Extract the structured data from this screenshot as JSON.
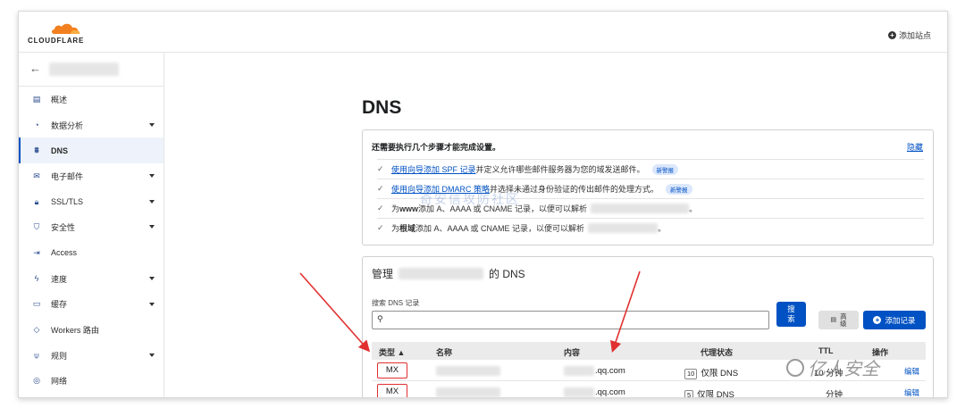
{
  "header": {
    "logo_text": "CLOUDFLARE",
    "add_site_label": "添加站点"
  },
  "sidebar": {
    "items": [
      {
        "label": "概述",
        "icon": "document-icon",
        "has_caret": false,
        "active": false
      },
      {
        "label": "数据分析",
        "icon": "clock-chart-icon",
        "has_caret": true,
        "active": false
      },
      {
        "label": "DNS",
        "icon": "network-icon",
        "has_caret": false,
        "active": true
      },
      {
        "label": "电子邮件",
        "icon": "email-icon",
        "has_caret": true,
        "active": false
      },
      {
        "label": "SSL/TLS",
        "icon": "lock-icon",
        "has_caret": true,
        "active": false
      },
      {
        "label": "安全性",
        "icon": "shield-icon",
        "has_caret": true,
        "active": false
      },
      {
        "label": "Access",
        "icon": "access-icon",
        "has_caret": false,
        "active": false
      },
      {
        "label": "速度",
        "icon": "lightning-icon",
        "has_caret": true,
        "active": false
      },
      {
        "label": "缓存",
        "icon": "storage-icon",
        "has_caret": true,
        "active": false
      },
      {
        "label": "Workers 路由",
        "icon": "workers-icon",
        "has_caret": false,
        "active": false
      },
      {
        "label": "规则",
        "icon": "rules-icon",
        "has_caret": true,
        "active": false
      },
      {
        "label": "网络",
        "icon": "location-icon",
        "has_caret": false,
        "active": false
      }
    ]
  },
  "main": {
    "title": "DNS",
    "setup": {
      "title": "还需要执行几个步骤才能完成设置。",
      "hide_label": "隐藏",
      "steps": [
        {
          "link": "使用向导添加 SPF 记录",
          "text": "并定义允许哪些邮件服务器为您的域发送邮件。",
          "badge": "新警报"
        },
        {
          "link": "使用向导添加 DMARC 策略",
          "text": "并选择未通过身份验证的传出邮件的处理方式。",
          "badge": "新警报"
        },
        {
          "prefix": "为 ",
          "bold": "www",
          "text": " 添加 A、AAAA 或 CNAME 记录，以便可以解析",
          "suffix": "。"
        },
        {
          "prefix": "为 ",
          "bold": "根域",
          "text": "添加 A、AAAA 或 CNAME 记录，以便可以解析",
          "suffix": "。"
        }
      ]
    },
    "dns": {
      "heading_prefix": "管理",
      "heading_suffix": "的 DNS",
      "search_label": "搜索 DNS 记录",
      "search_button": "搜\n索",
      "advanced_button": "高\n级",
      "add_record_button": "添加记录",
      "columns": {
        "type": "类型 ▲",
        "name": "名称",
        "content": "内容",
        "proxy": "代理状态",
        "ttl": "TTL",
        "actions": "操作"
      },
      "rows": [
        {
          "type": "MX",
          "content": ".qq.com",
          "priority": "10",
          "proxy": "仅限 DNS",
          "ttl": "10 分钟",
          "edit": "编辑"
        },
        {
          "type": "MX",
          "content": ".qq.com",
          "priority": "5",
          "proxy": "仅限 DNS",
          "ttl": "分钟",
          "edit": "编辑"
        }
      ]
    }
  },
  "watermarks": {
    "center": "奇安信攻防社区",
    "corner": "亿人安全"
  },
  "colors": {
    "accent": "#0051c3",
    "cloud_orange": "#f38020",
    "annotation_red": "#e03030"
  }
}
